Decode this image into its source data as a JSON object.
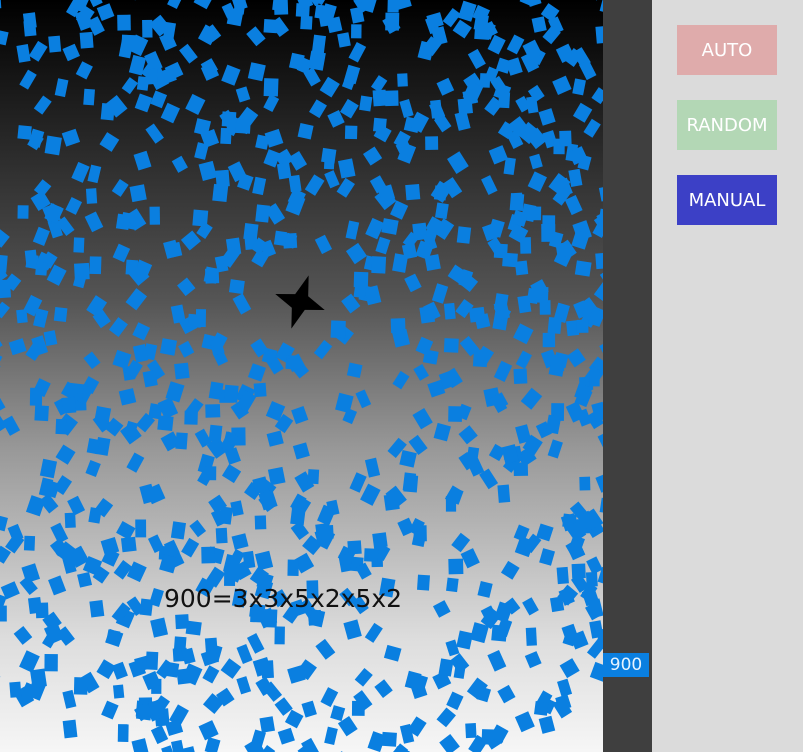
{
  "stage": {
    "formula_text": "900=3x3x5x2x5x2",
    "particle_color": "#0a7fe0",
    "particle_count": 900
  },
  "scrollbar": {
    "value_label": "900"
  },
  "controls": {
    "buttons": [
      {
        "label": "AUTO",
        "color": "#dfabab",
        "active": false
      },
      {
        "label": "RANDOM",
        "color": "#b3d7b5",
        "active": false
      },
      {
        "label": "MANUAL",
        "color": "#3c40c6",
        "active": true
      }
    ]
  },
  "icons": {
    "cursor": "star-icon"
  }
}
